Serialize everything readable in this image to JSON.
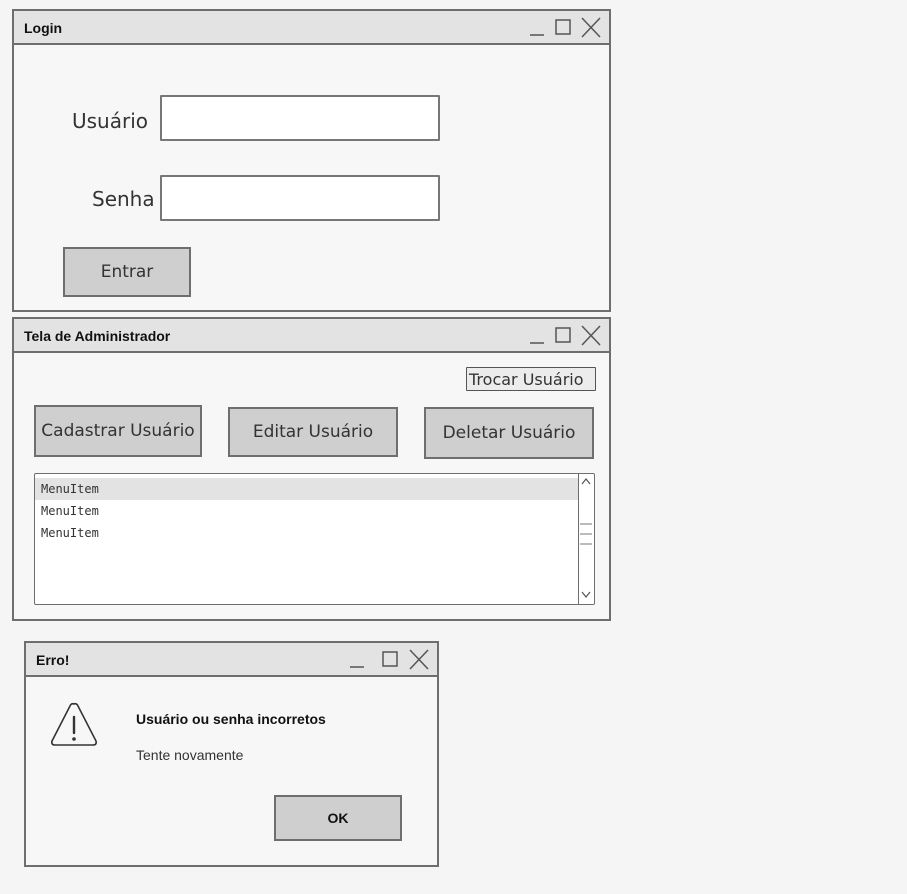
{
  "login": {
    "title": "Login",
    "user_label": "Usuário",
    "user_value": "",
    "pass_label": "Senha",
    "pass_value": "",
    "submit_label": "Entrar"
  },
  "admin": {
    "title": "Tela de Administrador",
    "switch_user_label": "Trocar Usuário",
    "create_label": "Cadastrar Usuário",
    "edit_label": "Editar Usuário",
    "delete_label": "Deletar Usuário",
    "list_items": [
      {
        "label": "MenuItem",
        "selected": true
      },
      {
        "label": "MenuItem",
        "selected": false
      },
      {
        "label": "MenuItem",
        "selected": false
      }
    ]
  },
  "error": {
    "title": "Erro!",
    "heading": "Usuário ou senha incorretos",
    "message": "Tente novamente",
    "ok_label": "OK"
  },
  "window_controls": [
    "minimize-icon",
    "maximize-icon",
    "close-icon"
  ],
  "icons": {
    "warning": "warning-triangle-icon"
  },
  "colors": {
    "titlebar": "#e3e3e3",
    "button": "#cfcfcf",
    "border": "#6e6e6e",
    "list_selected": "#e3e3e3"
  }
}
